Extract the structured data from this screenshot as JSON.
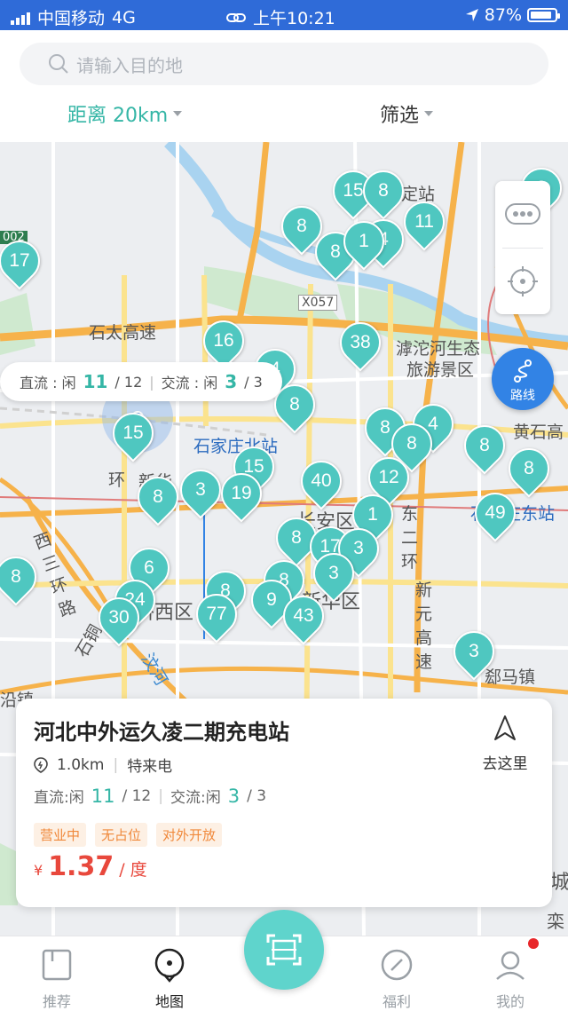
{
  "status_bar": {
    "carrier": "中国移动",
    "network": "4G",
    "time": "上午10:21",
    "battery": "87%",
    "battery_level": 0.87
  },
  "search": {
    "placeholder": "请输入目的地"
  },
  "filters": {
    "distance": "距离 20km",
    "filter": "筛选"
  },
  "map": {
    "labels": [
      "石太高速",
      "X057",
      "滹沱河生态",
      "旅游景区",
      "石家庄北站",
      "新华",
      "长安区",
      "东二环",
      "西三环路",
      "新元高速",
      "石铜",
      "桥西区",
      "汶河",
      "新华区",
      "郄马镇",
      "定站",
      "石家庄东站",
      "黄石高",
      "002",
      "沿镇",
      "环",
      "城",
      "栾"
    ],
    "pins": [
      "15",
      "8",
      "8",
      "11",
      "4",
      "8",
      "1",
      "17",
      "8",
      "16",
      "38",
      "4",
      "8",
      "8",
      "4",
      "8",
      "15",
      "8",
      "8",
      "12",
      "15",
      "3",
      "19",
      "40",
      "8",
      "1",
      "49",
      "8",
      "17",
      "3",
      "6",
      "24",
      "8",
      "8",
      "3",
      "77",
      "9",
      "43",
      "30",
      "3",
      "8"
    ]
  },
  "popup": {
    "dc_label": "直流 : 闲",
    "dc_free": "11",
    "dc_total": "/ 12",
    "ac_label": "交流 : 闲",
    "ac_free": "3",
    "ac_total": "/ 3"
  },
  "controls": {
    "route_label": "路线"
  },
  "station": {
    "name": "河北中外运久凌二期充电站",
    "distance": "1.0km",
    "operator": "特来电",
    "dc_label": "直流:闲",
    "dc_free": "11",
    "dc_total": "/ 12",
    "ac_label": "交流:闲",
    "ac_free": "3",
    "ac_total": "/ 3",
    "tags": [
      "营业中",
      "无占位",
      "对外开放"
    ],
    "price_symbol": "¥",
    "price": "1.37",
    "price_unit": "/ 度",
    "go_label": "去这里"
  },
  "tabs": [
    {
      "label": "推荐",
      "icon": "book-icon"
    },
    {
      "label": "地图",
      "icon": "map-pin-icon"
    },
    {
      "label": "福利",
      "icon": "compass-icon"
    },
    {
      "label": "我的",
      "icon": "user-icon"
    }
  ],
  "colors": {
    "accent": "#35b6a6",
    "pin": "#4fc7c0",
    "status_bar": "#2f6bd8",
    "price": "#e8483c",
    "route": "#3283e5"
  }
}
